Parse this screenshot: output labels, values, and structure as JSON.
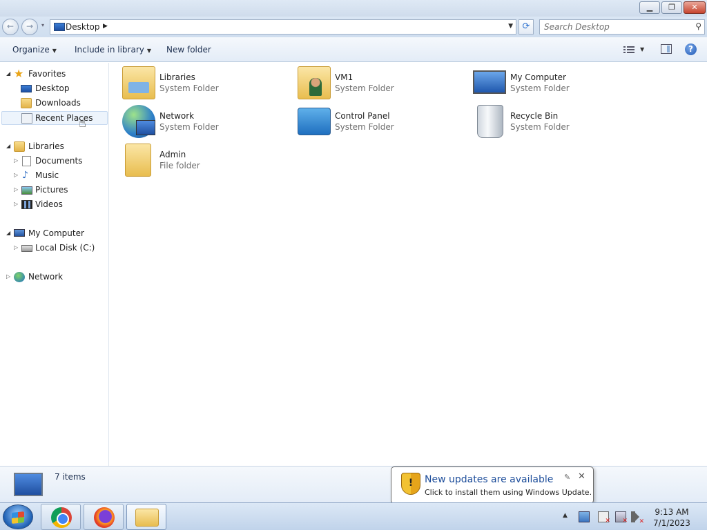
{
  "window": {
    "minimize_glyph": "▁",
    "maximize_glyph": "❐",
    "close_glyph": "✕"
  },
  "nav": {
    "back_glyph": "←",
    "forward_glyph": "→",
    "history_dropdown_glyph": "▾",
    "address_crumb": "Desktop",
    "crumb_arrow_glyph": "▶",
    "address_dropdown_glyph": "▼",
    "refresh_glyph": "⟳",
    "search_placeholder": "Search Desktop",
    "search_glyph": "⚲"
  },
  "toolbar": {
    "organize": "Organize",
    "include_in_library": "Include in library",
    "new_folder": "New folder",
    "dropdown_glyph": "▼",
    "help_glyph": "?"
  },
  "sidebar": {
    "expanded_glyph": "◢",
    "collapsed_glyph": "▷",
    "favorites": {
      "label": "Favorites",
      "star_glyph": "★",
      "items": [
        {
          "label": "Desktop",
          "icon": "desktop-icon"
        },
        {
          "label": "Downloads",
          "icon": "downloads-folder-icon"
        },
        {
          "label": "Recent Places",
          "icon": "recent-places-icon"
        }
      ]
    },
    "libraries": {
      "label": "Libraries",
      "items": [
        {
          "label": "Documents",
          "icon": "documents-icon"
        },
        {
          "label": "Music",
          "icon": "music-icon",
          "glyph": "♪"
        },
        {
          "label": "Pictures",
          "icon": "pictures-icon"
        },
        {
          "label": "Videos",
          "icon": "videos-icon"
        }
      ]
    },
    "computer": {
      "label": "My Computer",
      "items": [
        {
          "label": "Local Disk (C:)",
          "icon": "local-disk-icon"
        }
      ]
    },
    "network": {
      "label": "Network"
    }
  },
  "items": [
    {
      "name": "Libraries",
      "type": "System Folder",
      "icon": "libraries-icon"
    },
    {
      "name": "VM1",
      "type": "System Folder",
      "icon": "user-folder-icon"
    },
    {
      "name": "My Computer",
      "type": "System Folder",
      "icon": "computer-icon"
    },
    {
      "name": "Network",
      "type": "System Folder",
      "icon": "network-icon"
    },
    {
      "name": "Control Panel",
      "type": "System Folder",
      "icon": "control-panel-icon"
    },
    {
      "name": "Recycle Bin",
      "type": "System Folder",
      "icon": "recycle-bin-icon"
    },
    {
      "name": "Admin",
      "type": "File folder",
      "icon": "folder-icon"
    }
  ],
  "status": {
    "item_count": "7 items"
  },
  "notification": {
    "shield_glyph": "!",
    "title": "New updates are available",
    "text": "Click to install them using Windows Update.",
    "settings_glyph": "✎",
    "close_glyph": "✕"
  },
  "taskbar": {
    "apps": [
      "Google Chrome",
      "Mozilla Firefox",
      "Windows Explorer"
    ],
    "tray_overflow_glyph": "▲",
    "time": "9:13 AM",
    "date": "7/1/2023"
  },
  "colors": {
    "accent": "#1e4e9b",
    "secondary_text": "#6d6d6d",
    "chrome_bg": "#dce8f6"
  }
}
